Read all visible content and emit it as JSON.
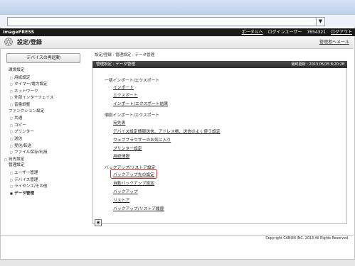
{
  "brand": "imagePRESS",
  "top_links": {
    "portal": "ポータルへ",
    "login_user_label": "ログインユーザー",
    "user_id": "7654321",
    "logout": "ログアウト"
  },
  "title": "設定/登録",
  "admin_mail": "管理者へメール",
  "restart_button": "デバイスの再起動",
  "sidebar": {
    "items": [
      {
        "label": "環境設定",
        "level": 1,
        "icon": ""
      },
      {
        "label": "用紙設定",
        "level": 2,
        "icon": "□"
      },
      {
        "label": "タイマー/電力設定",
        "level": 2,
        "icon": "□"
      },
      {
        "label": "ネットワーク",
        "level": 2,
        "icon": "□"
      },
      {
        "label": "外部インターフェイス",
        "level": 2,
        "icon": "□"
      },
      {
        "label": "音量調整",
        "level": 2,
        "icon": "□"
      },
      {
        "label": "ファンクション設定",
        "level": 1,
        "icon": ""
      },
      {
        "label": "共通",
        "level": 2,
        "icon": "□"
      },
      {
        "label": "コピー",
        "level": 2,
        "icon": "□"
      },
      {
        "label": "プリンター",
        "level": 2,
        "icon": "□"
      },
      {
        "label": "送信",
        "level": 2,
        "icon": "□"
      },
      {
        "label": "受信/転送",
        "level": 2,
        "icon": "□"
      },
      {
        "label": "ファイル保存/利用",
        "level": 2,
        "icon": "□"
      },
      {
        "label": "宛先設定",
        "level": 1,
        "icon": "□"
      },
      {
        "label": "管理設定",
        "level": 1,
        "icon": ""
      },
      {
        "label": "ユーザー管理",
        "level": 2,
        "icon": "□"
      },
      {
        "label": "デバイス管理",
        "level": 2,
        "icon": "□"
      },
      {
        "label": "ライセンス/その他",
        "level": 2,
        "icon": "□"
      },
      {
        "label": "データ管理",
        "level": 2,
        "icon": "■"
      }
    ]
  },
  "breadcrumb": "設定/登録 : 管理設定 : データ管理",
  "panel": {
    "title": "管理設定 : データ管理",
    "last_updated": "最終更新 : 2013 05/15 8:20:28"
  },
  "sections": [
    {
      "heading": "一括インポート/エクスポート",
      "links": [
        "インポート",
        "エクスポート",
        "インポート/エクスポート結果"
      ]
    },
    {
      "heading": "個別インポート/エクスポート",
      "links": [
        "宛先表",
        "デバイス設定情報送信、アドレス帳、送信のよく使う設定",
        "ウェブブラウザーのお気に入り",
        "プリンター設定",
        "用紙情報"
      ]
    },
    {
      "heading": "バックアップ/リストア設定",
      "links": [
        "バックアップ先の設定",
        "自動バックアップ設定",
        "バックアップ",
        "リストア",
        "バックアップ/リストア履歴"
      ]
    }
  ],
  "page_icon": "▣",
  "copyright": "Copyright CANON INC. 2013 All Rights Reserved",
  "url_dropdown": "▼",
  "colors": {
    "header_bg": "#1a1a1a",
    "highlight": "#e0241b"
  }
}
